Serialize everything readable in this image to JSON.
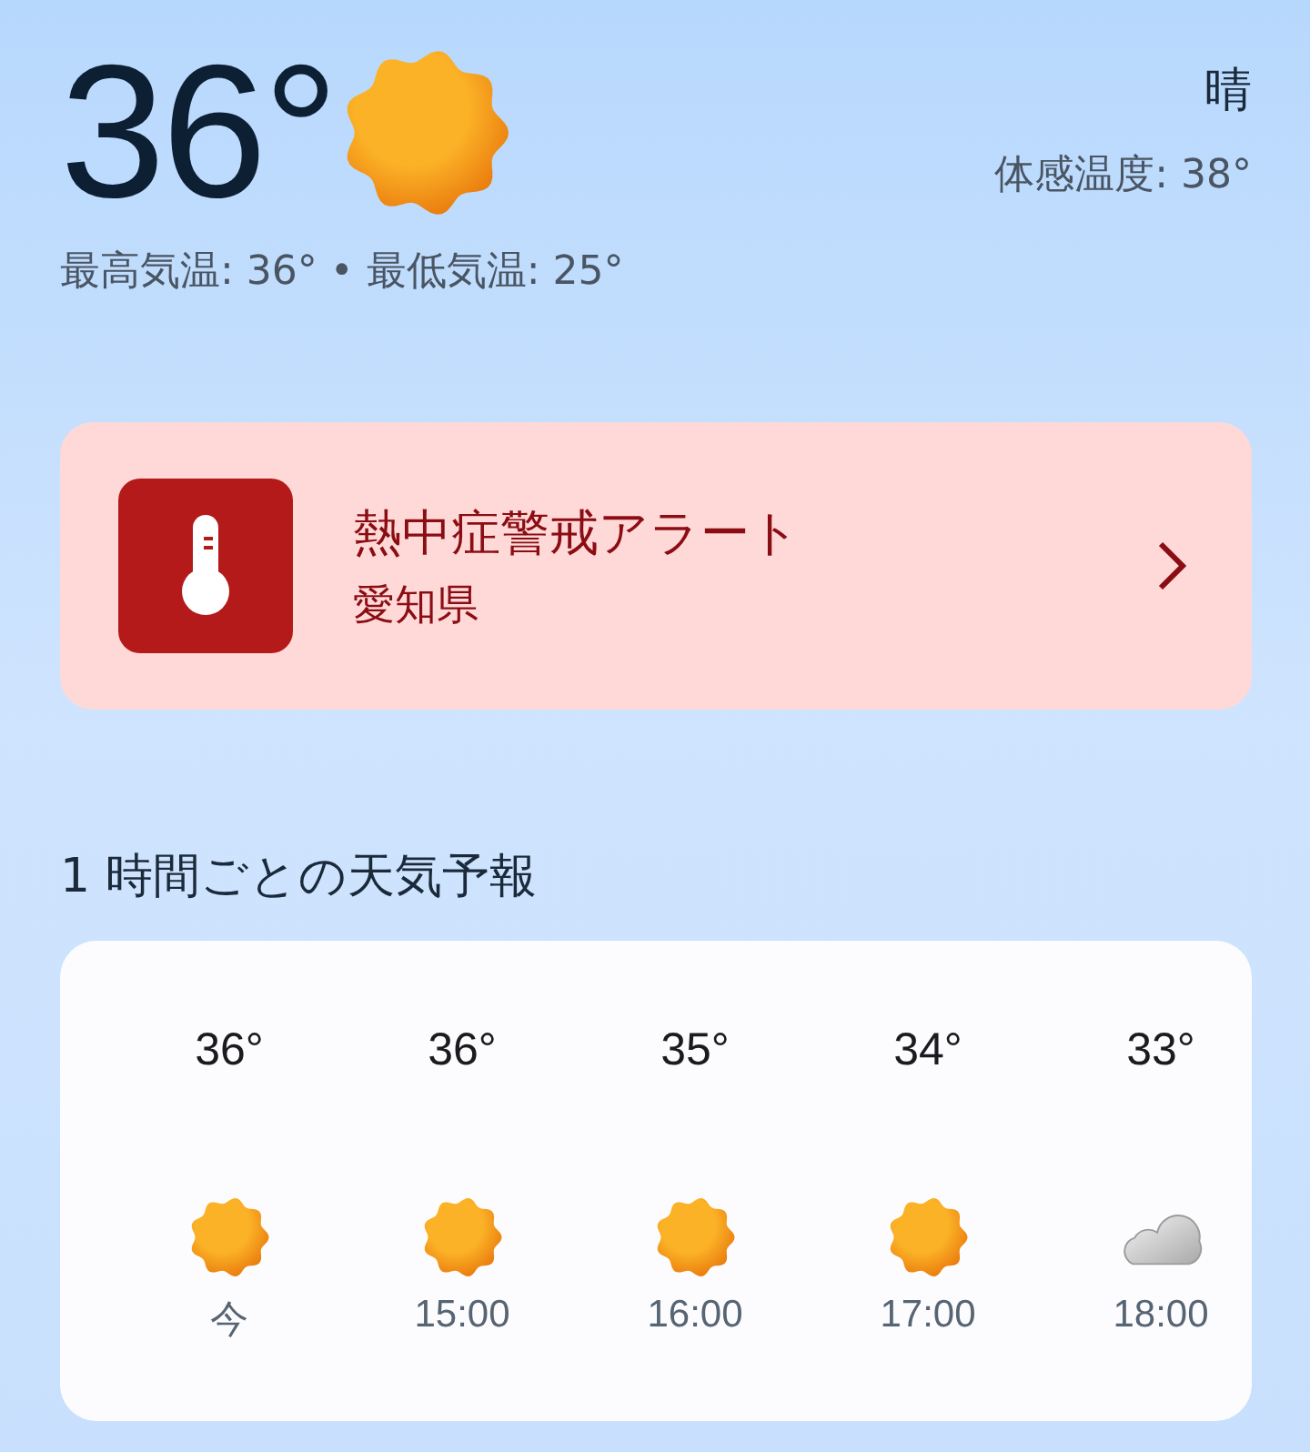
{
  "current": {
    "temperature": "36°",
    "condition": "晴",
    "feels_like": "体感温度: 38°",
    "high_low": "最高気温: 36° • 最低気温: 25°"
  },
  "alert": {
    "title": "熱中症警戒アラート",
    "region": "愛知県"
  },
  "hourly": {
    "title": "1 時間ごとの天気予報",
    "items": [
      {
        "temp": "36°",
        "kind": "sunny",
        "time": "今"
      },
      {
        "temp": "36°",
        "kind": "sunny",
        "time": "15:00"
      },
      {
        "temp": "35°",
        "kind": "sunny",
        "time": "16:00"
      },
      {
        "temp": "34°",
        "kind": "sunny",
        "time": "17:00"
      },
      {
        "temp": "33°",
        "kind": "cloudy",
        "time": "18:00"
      }
    ]
  }
}
